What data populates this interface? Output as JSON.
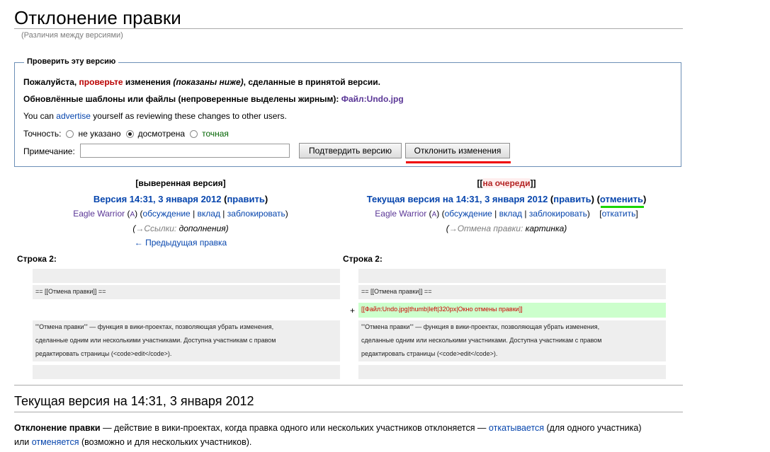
{
  "page": {
    "title": "Отклонение правки",
    "subtitle": "(Различия между версиями)"
  },
  "review": {
    "legend": "Проверить эту версию",
    "line1": {
      "before": "Пожалуйста, ",
      "link": "проверьте",
      "middle": " изменения ",
      "italic": "(показаны ниже)",
      "after": ", сделанные в принятой версии."
    },
    "line2": {
      "text": "Обновлённые шаблоны или файлы (непроверенные выделены жирным): ",
      "file_link": "Файл:Undo.jpg"
    },
    "line3": {
      "before": "You can ",
      "link": "advertise",
      "after": " yourself as reviewing these changes to other users."
    },
    "accuracy": {
      "label": "Точность:",
      "options": [
        {
          "label": "не указано",
          "checked": false
        },
        {
          "label": "досмотрена",
          "checked": true
        },
        {
          "label": "точная",
          "checked": false
        }
      ]
    },
    "note_label": "Примечание:",
    "note_value": "",
    "approve_button": "Подтвердить версию",
    "reject_button": "Отклонить изменения",
    "highlight_colors": {
      "reject_underline": "#ee0000",
      "undo_underline": "#1ad600"
    }
  },
  "diff": {
    "left": {
      "status": "[выверенная версия]",
      "revision": "Версия 14:31, 3 января 2012",
      "edit": "править",
      "user": "Eagle Warrior",
      "user_badge": "A",
      "talk": "обсуждение",
      "contribs": "вклад",
      "block": "заблокировать",
      "summary_arrow": "→Ссылки:",
      "summary_text": "дополнения",
      "prev_link": "← Предыдущая правка",
      "line_label": "Строка 2:"
    },
    "right": {
      "status_open": "[[",
      "status": "на очереди",
      "status_close": "]]",
      "revision": "Текущая версия на 14:31, 3 января 2012",
      "edit": "править",
      "undo": "отменить",
      "user": "Eagle Warrior",
      "user_badge": "A",
      "talk": "обсуждение",
      "contribs": "вклад",
      "block": "заблокировать",
      "rollback": "откатить",
      "summary_arrow": "→Отмена правки:",
      "summary_text": "картинка",
      "line_label": "Строка 2:"
    },
    "lines": {
      "heading": "== [[Отмена правки]] ==",
      "added": "[[Файл:Undo.jpg|thumb|left|320px|Окно отмены правки]]",
      "plus": "+",
      "para1": "'''Отмена правки''' — функция в вики-проектах, позволяющая убрать изменения,",
      "para2": "сделанные одним или несколькими участниками. Доступна участникам с правом",
      "para3": "редактировать страницы (<code>edit</code>)."
    }
  },
  "current": {
    "heading": "Текущая версия на 14:31, 3 января 2012",
    "bold": "Отклонение правки",
    "text1": " — действие в вики-проектах, когда правка одного или нескольких участников отклоняется — ",
    "link1": "откатывается",
    "text2": " (для одного участника)",
    "text3": "или ",
    "link2": "отменяется",
    "text4": " (возможно и для нескольких участников)."
  }
}
